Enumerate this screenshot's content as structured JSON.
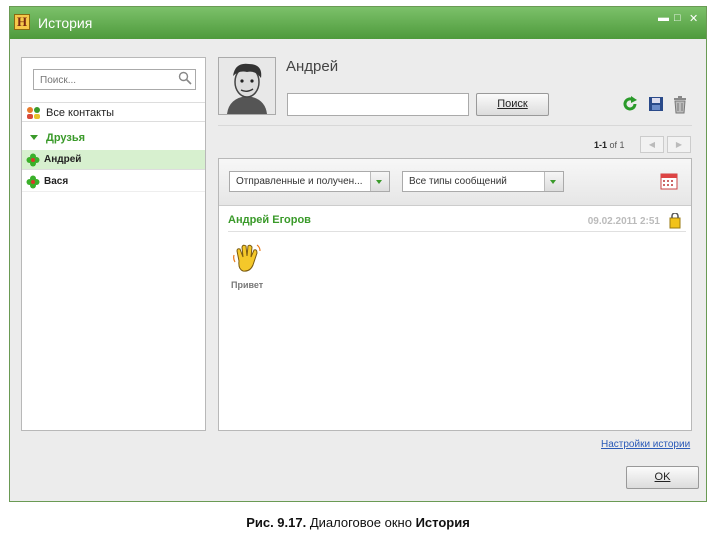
{
  "window": {
    "title": "История",
    "app_icon_letter": "H"
  },
  "left": {
    "search_placeholder": "Поиск...",
    "all_contacts": "Все контакты",
    "group": "Друзья",
    "contacts": [
      "Андрей",
      "Вася"
    ]
  },
  "contact": {
    "name": "Андрей"
  },
  "search_button": "Поиск",
  "pager": {
    "range": "1-1",
    "of": "of 1"
  },
  "filters": {
    "direction": "Отправленные и получен...",
    "type": "Все типы сообщений"
  },
  "message": {
    "sender": "Андрей Егоров",
    "time": "09.02.2011 2:51",
    "text": "Привет"
  },
  "settings_link": "Настройки истории",
  "ok_button": "OK",
  "caption": {
    "prefix": "Рис. 9.17.",
    "text": "Диалоговое окно",
    "bold": "История"
  },
  "colors": {
    "accent": "#3a9a2a",
    "titlebar": "#5aa848",
    "link": "#2a5ab8"
  }
}
